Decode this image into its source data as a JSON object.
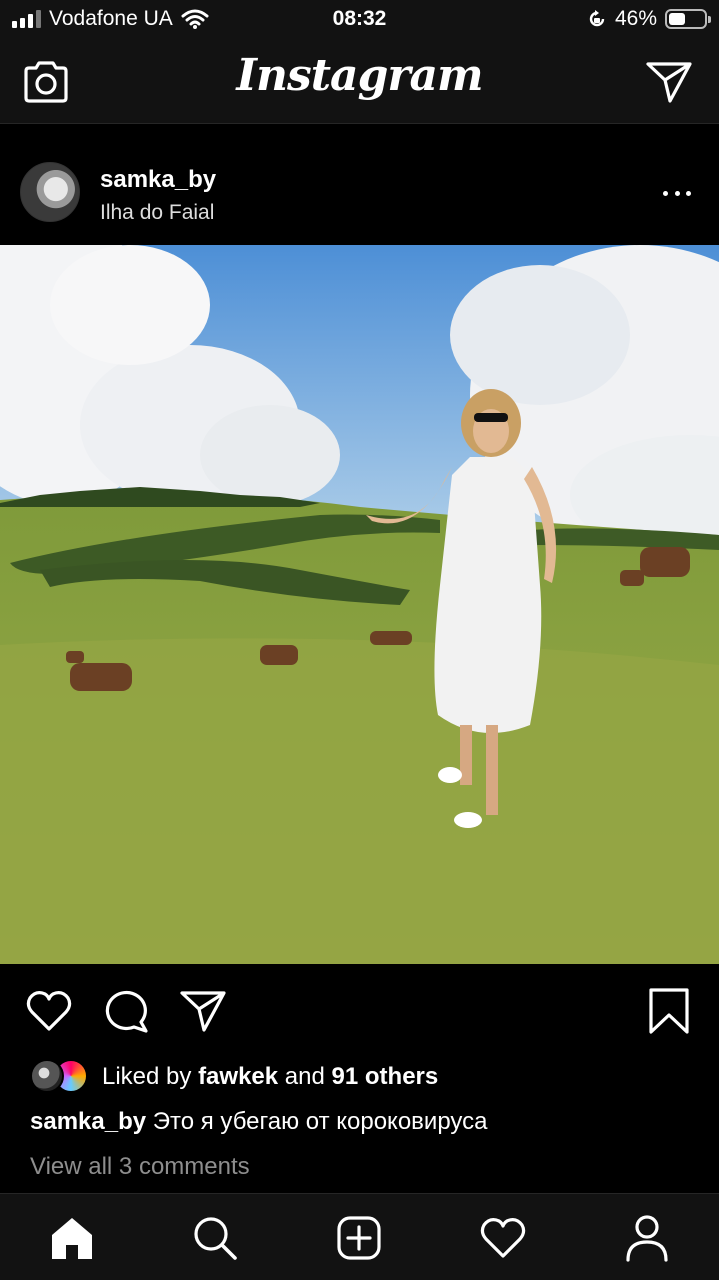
{
  "status_bar": {
    "carrier": "Vodafone UA",
    "time": "08:32",
    "battery_percent": "46%",
    "battery_level": 0.46,
    "icons": [
      "signal-icon",
      "wifi-icon",
      "orientation-lock-icon",
      "battery-icon"
    ]
  },
  "header": {
    "brand": "Instagram",
    "left_icon": "camera-icon",
    "right_icon": "direct-message-icon"
  },
  "post": {
    "username": "samka_by",
    "location": "Ilha do Faial",
    "more_icon": "more-options-icon",
    "photo_alt": "photo-post",
    "likes": {
      "prefix": "Liked by",
      "user": "fawkek",
      "joiner": "and",
      "others": "91 others"
    },
    "caption": {
      "username": "samka_by",
      "text": "Это я убегаю от короковируса"
    },
    "view_comments": "View all 3 comments"
  },
  "actions": [
    "like-icon",
    "comment-icon",
    "share-icon",
    "bookmark-icon"
  ],
  "tab_bar": [
    "home-icon",
    "search-icon",
    "new-post-icon",
    "activity-icon",
    "profile-icon"
  ],
  "colors": {
    "background": "#000000",
    "bar_background": "#121212",
    "secondary_text": "#8e8e8e"
  }
}
